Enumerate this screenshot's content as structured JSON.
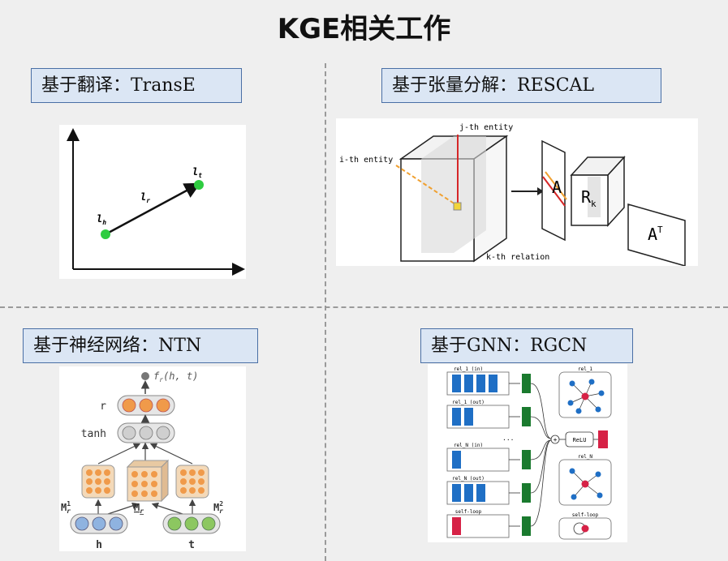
{
  "title": "KGE相关工作",
  "sections": {
    "transe": {
      "label": "基于翻译：TransE",
      "diagram": {
        "head": "l",
        "head_sub": "h",
        "relation": "l",
        "relation_sub": "r",
        "tail": "l",
        "tail_sub": "t"
      }
    },
    "rescal": {
      "label": "基于张量分解：RESCAL",
      "diagram": {
        "j_entity": "j-th entity",
        "i_entity": "i-th entity",
        "k_relation": "k-th relation",
        "matrix_a": "A",
        "matrix_r": "R",
        "matrix_r_sub": "k",
        "matrix_at": "A",
        "matrix_at_sup": "T"
      }
    },
    "ntn": {
      "label": "基于神经网络：NTN",
      "diagram": {
        "score": "f",
        "score_sub": "r",
        "score_args": "(h, t)",
        "r": "r",
        "tanh": "tanh",
        "m1": "M",
        "m1_sup": "1",
        "m1_sub": "r",
        "mr": "M",
        "mr_sub": "r",
        "m2": "M",
        "m2_sup": "2",
        "m2_sub": "r",
        "h": "h",
        "t": "t"
      }
    },
    "rgcn": {
      "label": "基于GNN：RGCN",
      "diagram": {
        "rows": [
          "rel_1 (in)",
          "rel_1 (out)",
          "...",
          "rel_N (in)",
          "rel_N (out)",
          "self-loop"
        ],
        "graphs": [
          "rel_1",
          "rel_N",
          "self-loop"
        ],
        "relu": "ReLU",
        "plus": "+"
      }
    }
  }
}
